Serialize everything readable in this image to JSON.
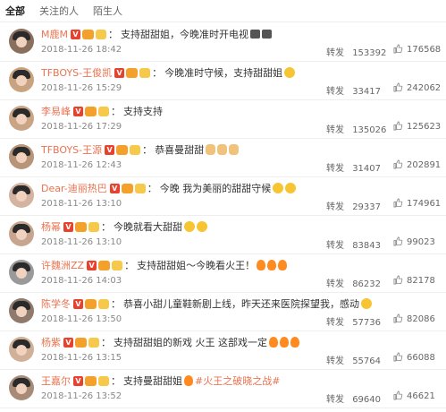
{
  "tabs": [
    {
      "label": "全部",
      "active": true
    },
    {
      "label": "关注的人",
      "active": false
    },
    {
      "label": "陌生人",
      "active": false
    }
  ],
  "repost_label": "转发",
  "comments": [
    {
      "user": "M鹿M",
      "text": "支持甜甜姐，今晚准时开电视",
      "emojis": [
        "tv",
        "tv"
      ],
      "topic": "",
      "date": "2018-11-26 18:42",
      "reposts": "153392",
      "likes": "176568",
      "avatar_color": "#8b6f5e"
    },
    {
      "user": "TFBOYS-王俊凯",
      "text": "今晚准时守候，支持甜甜姐",
      "emojis": [
        "smile"
      ],
      "topic": "",
      "date": "2018-11-26 15:29",
      "reposts": "33417",
      "likes": "242062",
      "avatar_color": "#c9a37f"
    },
    {
      "user": "李易峰",
      "text": "支持支持",
      "emojis": [],
      "topic": "",
      "date": "2018-11-26 17:29",
      "reposts": "135026",
      "likes": "125623",
      "avatar_color": "#caa585"
    },
    {
      "user": "TFBOYS-王源",
      "text": "恭喜曼甜甜",
      "emojis": [
        "hand",
        "hand",
        "hand"
      ],
      "topic": "",
      "date": "2018-11-26 12:43",
      "reposts": "31407",
      "likes": "202891",
      "avatar_color": "#b89578"
    },
    {
      "user": "Dear-迪丽热巴",
      "text": "今晚 我为美丽的甜甜守候",
      "emojis": [
        "smile",
        "smile"
      ],
      "topic": "",
      "date": "2018-11-26 13:10",
      "reposts": "29337",
      "likes": "174961",
      "avatar_color": "#d4b3a0"
    },
    {
      "user": "杨幂",
      "text": "今晚就看大甜甜",
      "emojis": [
        "smile",
        "smile"
      ],
      "topic": "",
      "date": "2018-11-26 13:10",
      "reposts": "83843",
      "likes": "99023",
      "avatar_color": "#c7a58e"
    },
    {
      "user": "许魏洲ZZ",
      "text": "支持甜甜姐～今晚看火王！",
      "emojis": [
        "fire",
        "fire",
        "fire"
      ],
      "topic": "",
      "date": "2018-11-26 14:03",
      "reposts": "86232",
      "likes": "82178",
      "avatar_color": "#9a9a9a"
    },
    {
      "user": "陈学冬",
      "text": "恭喜小甜儿童鞋新剧上线，昨天还来医院探望我，感动",
      "emojis": [
        "smile"
      ],
      "topic": "",
      "date": "2018-11-26 13:50",
      "reposts": "57736",
      "likes": "82086",
      "avatar_color": "#8f7a6d"
    },
    {
      "user": "杨紫",
      "text": "支持甜甜姐的新戏 火王 这部戏一定",
      "emojis": [
        "fire",
        "fire",
        "fire"
      ],
      "topic": "",
      "date": "2018-11-26 13:15",
      "reposts": "55764",
      "likes": "66088",
      "avatar_color": "#d1b09a"
    },
    {
      "user": "王嘉尔",
      "text": "支持曼甜甜姐",
      "emojis": [
        "fire"
      ],
      "topic": "#火王之破晓之战#",
      "date": "2018-11-26 13:52",
      "reposts": "69640",
      "likes": "46621",
      "avatar_color": "#a88b77"
    }
  ]
}
